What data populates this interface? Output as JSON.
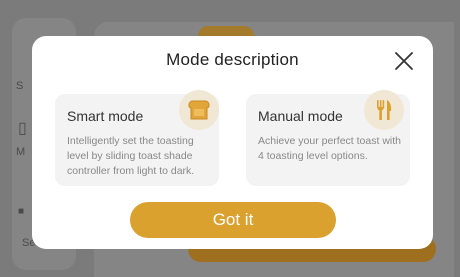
{
  "background": {
    "sidebar_labels": [
      "S",
      "M",
      "Se"
    ]
  },
  "modal": {
    "title": "Mode description",
    "close_icon": "close-icon",
    "cards": [
      {
        "title": "Smart mode",
        "description": "Intelligently set the toasting level by sliding toast shade controller from light to dark.",
        "icon": "toast-icon"
      },
      {
        "title": "Manual mode",
        "description": "Achieve your perfect toast with 4 toasting level options.",
        "icon": "fork-knife-icon"
      }
    ],
    "confirm_label": "Got it"
  },
  "colors": {
    "accent": "#dba12e",
    "icon_bg": "#f0e7d4",
    "card_bg": "#f3f3f3",
    "overlay": "#7b7b7b"
  }
}
